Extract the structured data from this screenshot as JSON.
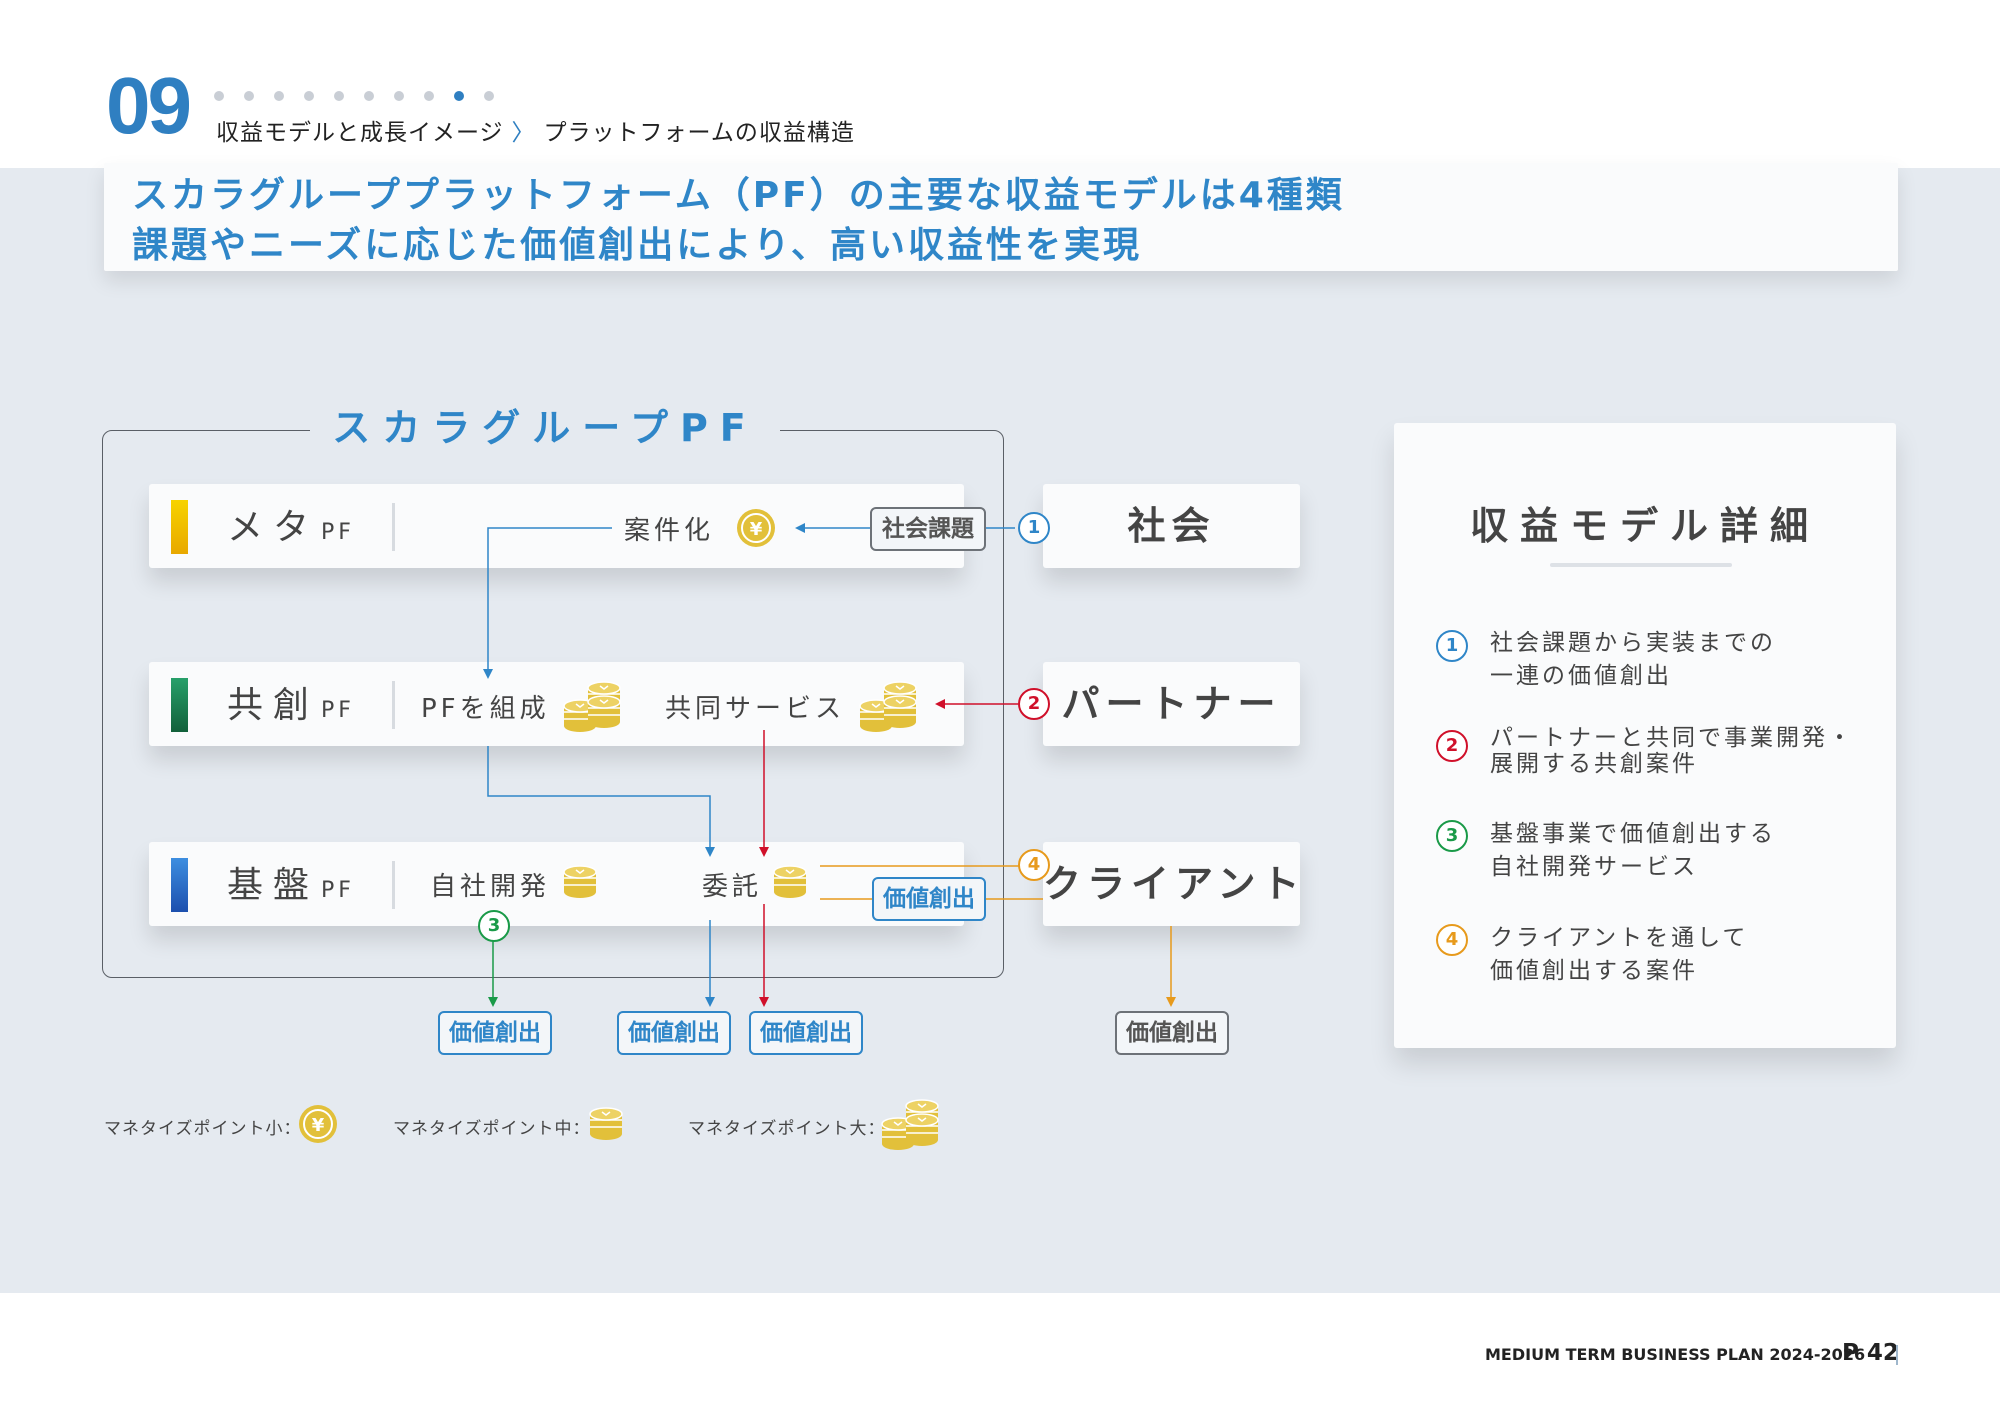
{
  "colors": {
    "accent_blue": "#2f86c8",
    "meta_yellow": "#f2c400",
    "kyoso_green": "#1e8a55",
    "kiban_blue": "#2c6fc6",
    "red": "#d0102a",
    "green": "#1a9a48",
    "orange": "#e79a1c",
    "coin_gold": "#e2c03a"
  },
  "header": {
    "section_number": "09",
    "breadcrumb_parent": "収益モデルと成長イメージ",
    "breadcrumb_sep": "〉",
    "breadcrumb_current": "プラットフォームの収益構造",
    "dots_total": 10,
    "dots_active_index": 8
  },
  "headline": {
    "line1": "スカラグループプラットフォーム（PF）の主要な収益モデルは4種類",
    "line2": "課題やニーズに応じた価値創出により、高い収益性を実現"
  },
  "diagram": {
    "frame_title": "スカラグループPF",
    "rows": {
      "meta": {
        "name": "メタ",
        "suffix": "PF"
      },
      "kyoso": {
        "name": "共創",
        "suffix": "PF"
      },
      "kiban": {
        "name": "基盤",
        "suffix": "PF"
      }
    },
    "labels": {
      "anken": "案件化",
      "pf_sosei": "PFを組成",
      "kyodo_service": "共同サービス",
      "jisha_kaihatsu": "自社開発",
      "itaku": "委託"
    },
    "tags": {
      "shakai_kadai": "社会課題",
      "kachi": "価値創出"
    },
    "entities": {
      "shakai": "社会",
      "partner": "パートナー",
      "client": "クライアント"
    },
    "numbers": [
      "1",
      "2",
      "3",
      "4"
    ]
  },
  "panel": {
    "title": "収益モデル詳細",
    "items": [
      {
        "num": "1",
        "line1": "社会課題から実装までの",
        "line2": "一連の価値創出"
      },
      {
        "num": "2",
        "line1": "パートナーと共同で事業開発・",
        "line2": "展開する共創案件"
      },
      {
        "num": "3",
        "line1": "基盤事業で価値創出する",
        "line2": "自社開発サービス"
      },
      {
        "num": "4",
        "line1": "クライアントを通して",
        "line2": "価値創出する案件"
      }
    ]
  },
  "legend": {
    "small": "マネタイズポイント小：",
    "medium": "マネタイズポイント中：",
    "large": "マネタイズポイント大："
  },
  "footer": {
    "plan": "MEDIUM TERM BUSINESS PLAN 2024-2026",
    "page": "P 42"
  }
}
